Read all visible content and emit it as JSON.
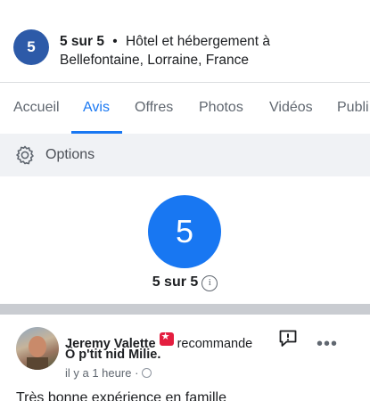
{
  "header": {
    "badge": "5",
    "rating": "5 sur 5",
    "separator": "•",
    "category": "Hôtel et hébergement à",
    "location": "Bellefontaine, Lorraine, France"
  },
  "tabs": [
    {
      "label": "Accueil",
      "active": false
    },
    {
      "label": "Avis",
      "active": true
    },
    {
      "label": "Offres",
      "active": false
    },
    {
      "label": "Photos",
      "active": false
    },
    {
      "label": "Vidéos",
      "active": false
    },
    {
      "label": "Publi",
      "active": false
    }
  ],
  "options": {
    "label": "Options",
    "icon": "gear-icon"
  },
  "rating_summary": {
    "value": "5",
    "text": "5 sur 5",
    "info_icon": "i"
  },
  "review": {
    "author": "Jeremy Valette",
    "action": "recommande",
    "place": "Ô p'tit nid Milie.",
    "time": "il y a 1 heure",
    "separator": "·",
    "more": "•••",
    "text": "Très bonne expérience en famille"
  },
  "colors": {
    "accent": "#1877f2",
    "header_badge": "#2d5aa8",
    "recommend_icon": "#e41e3f",
    "options_bg": "#f0f2f5"
  }
}
